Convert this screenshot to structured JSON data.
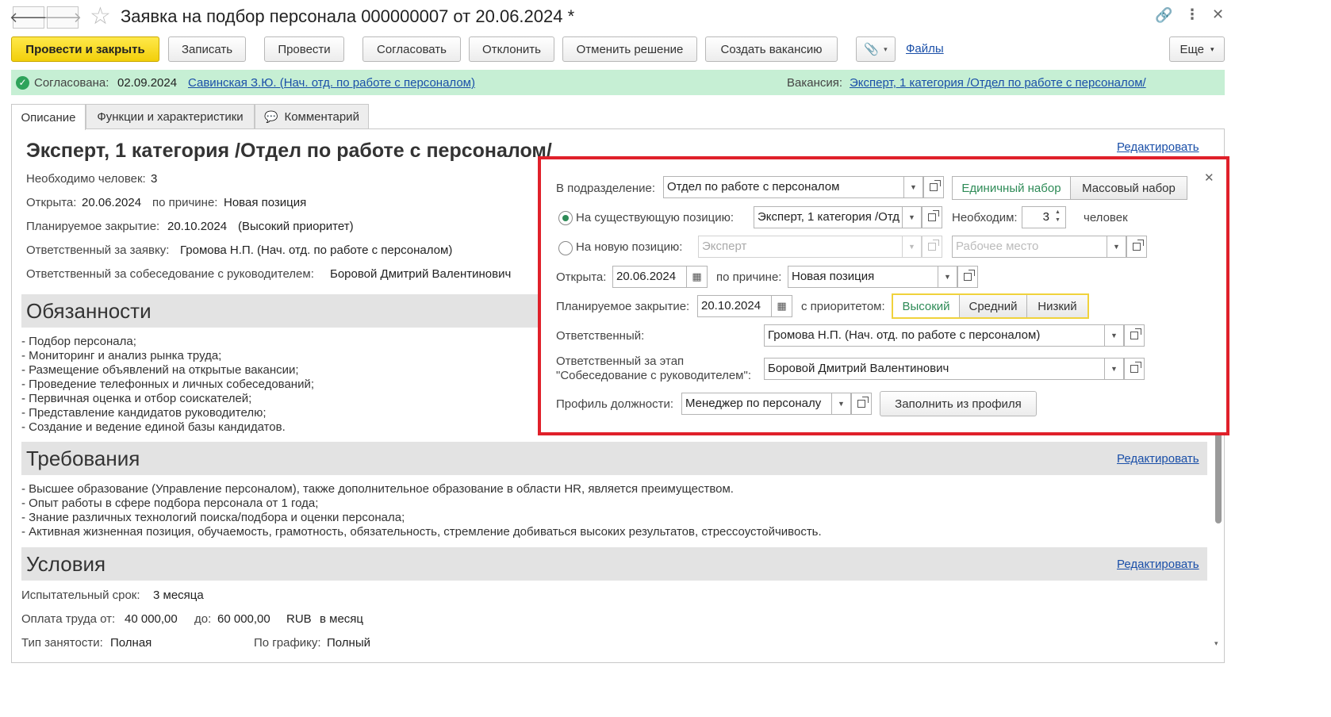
{
  "window": {
    "title": "Заявка на подбор персонала 000000007 от 20.06.2024 *"
  },
  "toolbar": {
    "post_close": "Провести и закрыть",
    "save": "Записать",
    "post": "Провести",
    "approve": "Согласовать",
    "reject": "Отклонить",
    "cancel_decision": "Отменить решение",
    "create_vacancy": "Создать вакансию",
    "files": "Файлы",
    "more": "Еще"
  },
  "status": {
    "approved_label": "Согласована:",
    "approved_date": "02.09.2024",
    "approved_by": "Савинская З.Ю. (Нач. отд. по работе с персоналом)",
    "vacancy_label": "Вакансия:",
    "vacancy_link": "Эксперт, 1 категория /Отдел по работе с персоналом/",
    "color": "#c6efd4"
  },
  "tabs": [
    {
      "label": "Описание"
    },
    {
      "label": "Функции и характеристики"
    },
    {
      "label": "Комментарий"
    }
  ],
  "summary": {
    "heading": "Эксперт, 1 категория /Отдел по работе с персоналом/",
    "edit": "Редактировать",
    "people_label": "Необходимо человек:",
    "people_value": "3",
    "opened_label": "Открыта:",
    "opened_value": "20.06.2024",
    "reason_label": "по причине:",
    "reason_value": "Новая позиция",
    "close_label": "Планируемое закрытие:",
    "close_value": "20.10.2024",
    "close_priority": "(Высокий приоритет)",
    "resp_label": "Ответственный за заявку:",
    "resp_value": "Громова Н.П. (Нач. отд. по работе с персоналом)",
    "interview_label": "Ответственный за собеседование с руководителем:",
    "interview_value": "Боровой Дмитрий Валентинович"
  },
  "duties": {
    "title": "Обязанности",
    "items": [
      "- Подбор персонала;",
      "- Мониторинг и анализ рынка труда;",
      "- Размещение объявлений на открытые вакансии;",
      "- Проведение телефонных и личных собеседований;",
      "- Первичная оценка и отбор соискателей;",
      "- Представление кандидатов руководителю;",
      "- Создание и ведение единой базы кандидатов."
    ]
  },
  "requirements": {
    "title": "Требования",
    "edit": "Редактировать",
    "items": [
      "- Высшее образование (Управление персоналом), также дополнительное образование в области HR, является преимуществом.",
      "- Опыт работы в сфере подбора персонала от 1 года;",
      "- Знание различных технологий поиска/подбора и оценки персонала;",
      "- Активная жизненная позиция, обучаемость, грамотность, обязательность, стремление добиваться высоких результатов, стрессоустойчивость."
    ]
  },
  "conditions": {
    "title": "Условия",
    "edit": "Редактировать",
    "probation_label": "Испытательный срок:",
    "probation_value": "3 месяца",
    "pay_from_label": "Оплата труда от:",
    "pay_from_value": "40 000,00",
    "pay_to_label": "до:",
    "pay_to_value": "60 000,00",
    "currency": "RUB",
    "period": "в месяц",
    "employment_label": "Тип занятости:",
    "employment_value": "Полная",
    "schedule_label": "По графику:",
    "schedule_value": "Полный"
  },
  "popup": {
    "border_color": "#e0202a",
    "dept_label": "В подразделение:",
    "dept_value": "Отдел по работе с персоналом",
    "single": "Единичный набор",
    "mass": "Массовый набор",
    "existing_label": "На существующую позицию:",
    "existing_value": "Эксперт, 1 категория /Отд",
    "need_label": "Необходим:",
    "need_value": "3",
    "people_unit": "человек",
    "new_label": "На новую позицию:",
    "new_value": "Эксперт",
    "workplace_placeholder": "Рабочее место",
    "opened_label": "Открыта:",
    "opened_value": "20.06.2024",
    "reason_label": "по причине:",
    "reason_value": "Новая позиция",
    "close_label": "Планируемое закрытие:",
    "close_value": "20.10.2024",
    "priority_label": "с приоритетом:",
    "priorities": [
      "Высокий",
      "Средний",
      "Низкий"
    ],
    "resp_label": "Ответственный:",
    "resp_value": "Громова Н.П. (Нач. отд. по работе с персоналом)",
    "stage_label_1": "Ответственный за этап",
    "stage_label_2": "\"Собеседование с руководителем\":",
    "stage_value": "Боровой Дмитрий Валентинович",
    "profile_label": "Профиль должности:",
    "profile_value": "Менеджер по персоналу",
    "fill_button": "Заполнить из профиля"
  }
}
